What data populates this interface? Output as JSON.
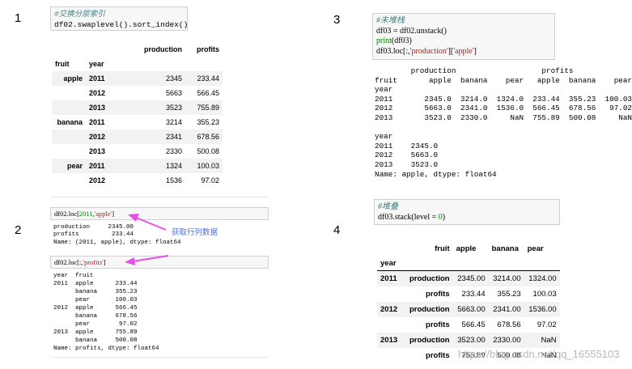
{
  "numbers": {
    "n1": "1",
    "n2": "2",
    "n3": "3",
    "n4": "4"
  },
  "cell1": {
    "comment": "#交换分层索引",
    "code": "df02.swaplevel().sort_index()",
    "cols": [
      "production",
      "profits"
    ],
    "index_names": [
      "fruit",
      "year"
    ],
    "rows": [
      {
        "fruit": "apple",
        "year": "2011",
        "production": "2345",
        "profits": "233.44"
      },
      {
        "fruit": "",
        "year": "2012",
        "production": "5663",
        "profits": "566.45"
      },
      {
        "fruit": "",
        "year": "2013",
        "production": "3523",
        "profits": "755.89"
      },
      {
        "fruit": "banana",
        "year": "2011",
        "production": "3214",
        "profits": "355.23"
      },
      {
        "fruit": "",
        "year": "2012",
        "production": "2341",
        "profits": "678.56"
      },
      {
        "fruit": "",
        "year": "2013",
        "production": "2330",
        "profits": "500.08"
      },
      {
        "fruit": "pear",
        "year": "2011",
        "production": "1324",
        "profits": "100.03"
      },
      {
        "fruit": "",
        "year": "2012",
        "production": "1536",
        "profits": "97.02"
      }
    ]
  },
  "cell2": {
    "code_a_prefix": "df02.loc[",
    "code_a_num": "2011",
    "code_a_mid": ",",
    "code_a_str": "'apple'",
    "code_a_suffix": "]",
    "annotation": "获取行列数据",
    "output_a": "production     2345.00\nprofits         233.44\nName: (2011, apple), dtype: float64",
    "code_b_prefix": "df02.loc[:,",
    "code_b_str": "'profits'",
    "code_b_suffix": "]",
    "output_b": "year  fruit\n2011  apple      233.44\n      banana     355.23\n      pear       100.03\n2012  apple      566.45\n      banana     678.56\n      pear        97.02\n2013  apple      755.89\n      banana     500.08\nName: profits, dtype: float64"
  },
  "cell3": {
    "comment": "#未堆栈",
    "line1": "df03 = df02.unstack()",
    "line2_fn": "print",
    "line2_rest": "(df03)",
    "line3_prefix": "df03.loc[:,",
    "line3_str1": "'production'",
    "line3_mid": "][",
    "line3_str2": "'apple'",
    "line3_suffix": "]",
    "output": "        production                   profits\nfruit       apple  banana    pear   apple  banana    pear\nyear\n2011       2345.0  3214.0  1324.0  233.44  355.23  100.03\n2012       5663.0  2341.0  1536.0  566.45  678.56   97.02\n2013       3523.0  2330.0     NaN  755.89  500.08     NaN\n\nyear\n2011    2345.0\n2012    5663.0\n2013    3523.0\nName: apple, dtype: float64"
  },
  "cell4": {
    "comment": "#堆叠",
    "code_prefix": "df03.stack(level = ",
    "code_num": "0",
    "code_suffix": ")",
    "header_col_name": "fruit",
    "cols": [
      "apple",
      "banana",
      "pear"
    ],
    "index_name": "year",
    "rows": [
      {
        "year": "2011",
        "level": "production",
        "apple": "2345.00",
        "banana": "3214.00",
        "pear": "1324.00"
      },
      {
        "year": "",
        "level": "profits",
        "apple": "233.44",
        "banana": "355.23",
        "pear": "100.03"
      },
      {
        "year": "2012",
        "level": "production",
        "apple": "5663.00",
        "banana": "2341.00",
        "pear": "1536.00"
      },
      {
        "year": "",
        "level": "profits",
        "apple": "566.45",
        "banana": "678.56",
        "pear": "97.02"
      },
      {
        "year": "2013",
        "level": "production",
        "apple": "3523.00",
        "banana": "2330.00",
        "pear": "NaN"
      },
      {
        "year": "",
        "level": "profits",
        "apple": "755.89",
        "banana": "500.08",
        "pear": "NaN"
      }
    ]
  },
  "watermark": "https://blog.csdn.net/qq_16555103",
  "colors": {
    "arrow": "#e84de8",
    "annotation": "#4a6fd8"
  }
}
